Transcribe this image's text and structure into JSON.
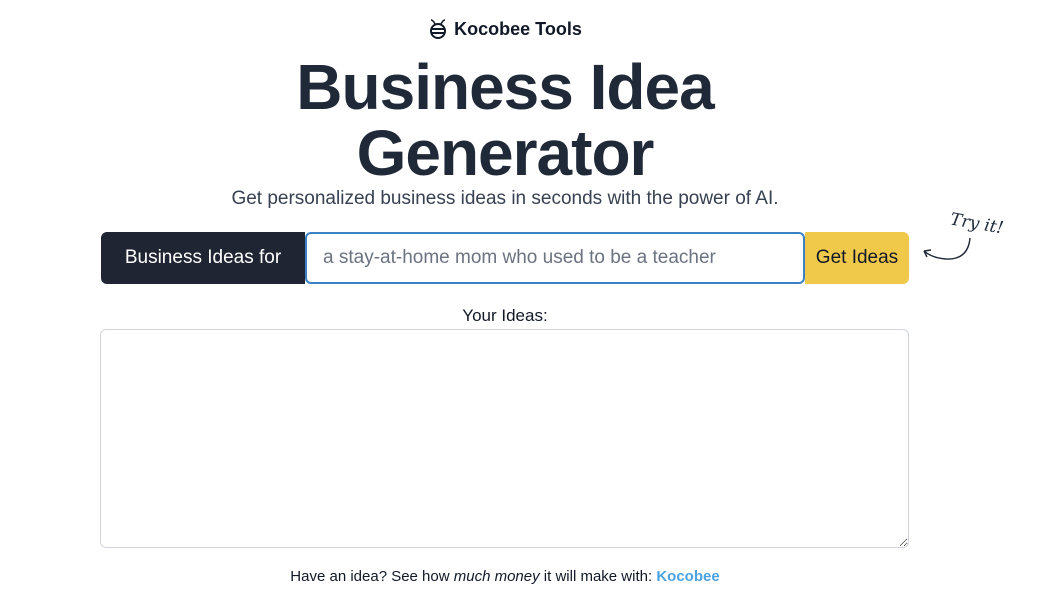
{
  "brand": {
    "name": "Kocobee Tools",
    "logo_icon": "bee-icon"
  },
  "hero": {
    "title_line1": "Business Idea",
    "title_line2": "Generator",
    "subtitle": "Get personalized business ideas in seconds with the power of AI."
  },
  "form": {
    "prefix_label": "Business Ideas for",
    "input_value": "",
    "input_placeholder": "a stay-at-home mom who used to be a teacher",
    "submit_label": "Get Ideas"
  },
  "hint": {
    "text": "Try it!",
    "arrow_icon": "curved-arrow-icon"
  },
  "results": {
    "label": "Your Ideas:",
    "value": ""
  },
  "footer": {
    "prefix": "Have an idea? See how ",
    "emphasis": "much money",
    "middle": " it will make with: ",
    "link_label": "Kocobee"
  },
  "colors": {
    "prefix_bg": "#1f2532",
    "submit_bg": "#f0c94b",
    "input_border": "#3b82c4",
    "link": "#4aa3e0"
  }
}
